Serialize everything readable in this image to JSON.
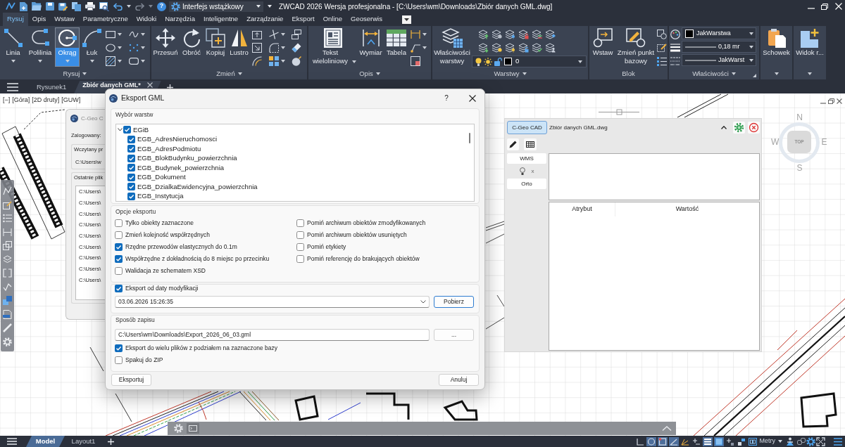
{
  "title_bar": {
    "help": "?",
    "workspace": "Interfejs wstążkowy",
    "title": "ZWCAD 2026 Wersja profesjonalna - [C:\\Users\\wm\\Downloads\\Zbiór danych GML.dwg]"
  },
  "ribbon_tabs": [
    {
      "label": "Rysuj",
      "selected": true
    },
    {
      "label": "Opis",
      "selected": false
    },
    {
      "label": "Wstaw",
      "selected": false
    },
    {
      "label": "Parametryczne",
      "selected": false
    },
    {
      "label": "Widoki",
      "selected": false
    },
    {
      "label": "Narzędzia",
      "selected": false
    },
    {
      "label": "Inteligentne",
      "selected": false
    },
    {
      "label": "Zarządzanie",
      "selected": false
    },
    {
      "label": "Eksport",
      "selected": false
    },
    {
      "label": "Online",
      "selected": false
    },
    {
      "label": "Geoserwis",
      "selected": false
    }
  ],
  "ribbon_groups": [
    {
      "kind": "draw",
      "label": "Rysuj",
      "dropdown": true,
      "buttons": [
        {
          "label": "Linia",
          "selected": false
        },
        {
          "label": "Polilinia",
          "selected": false
        },
        {
          "label": "Okrąg",
          "selected": true
        },
        {
          "label": "Łuk",
          "selected": false
        }
      ]
    },
    {
      "kind": "modify",
      "label": "Zmień",
      "dropdown": true,
      "buttons": [
        {
          "label": "Przesuń"
        },
        {
          "label": "Obróć"
        },
        {
          "label": "Kopiuj"
        },
        {
          "label": "Lustro"
        }
      ]
    },
    {
      "kind": "annotate",
      "label": "Opis",
      "dropdown": true,
      "buttons": [
        {
          "label": "Tekst wieloliniowy"
        },
        {
          "label": "Wymiar"
        },
        {
          "label": "Tabela"
        }
      ]
    },
    {
      "kind": "layers",
      "label": "Warstwy",
      "dropdown": true,
      "buttons": [
        {
          "label": "Właściwości warstwy"
        }
      ],
      "current_layer": "0"
    },
    {
      "kind": "block",
      "label": "Blok",
      "dropdown": false,
      "buttons": [
        {
          "label": "Wstaw"
        },
        {
          "label": "Zmień punkt bazowy"
        }
      ]
    },
    {
      "kind": "properties",
      "label": "Właściwości",
      "dropdown": true,
      "color_setting": "JakWarstwa",
      "lineweight": "0,18 mr",
      "linetype": "JakWarst"
    },
    {
      "kind": "clipboard",
      "dropdown": true,
      "buttons": [
        {
          "label": "Schowek"
        }
      ]
    },
    {
      "kind": "view",
      "dropdown": true,
      "buttons": [
        {
          "label": "Widok r..."
        }
      ]
    }
  ],
  "document_tabs": [
    {
      "label": "Rysunek1",
      "selected": false
    },
    {
      "label": "Zbiór danych GML*",
      "selected": true
    }
  ],
  "viewport_label": [
    "[−]",
    "[Góra]",
    "[2D druty]",
    "[GUW]"
  ],
  "background_dialog": {
    "title": "C-Geo C",
    "logged_in": "Zalogowany:",
    "project_group": "Wczytany pr",
    "project_path": "C:\\Users\\w",
    "recent_group": "Ostatnie plik",
    "recent_files": [
      "C:\\Users\\",
      "C:\\Users\\",
      "C:\\Users\\",
      "C:\\Users\\",
      "C:\\Users\\",
      "C:\\Users\\",
      "C:\\Users\\",
      "C:\\Users\\",
      "C:\\Users\\"
    ]
  },
  "export_dialog": {
    "title": "Eksport GML",
    "help": "?",
    "layer_group": {
      "title": "Wybór warstw",
      "tree": [
        {
          "label": "EGiB",
          "checked": true,
          "expanded": true,
          "children": [
            {
              "label": "EGB_AdresNieruchomosci",
              "checked": true
            },
            {
              "label": "EGB_AdresPodmiotu",
              "checked": true
            },
            {
              "label": "EGB_BlokBudynku_powierzchnia",
              "checked": true
            },
            {
              "label": "EGB_Budynek_powierzchnia",
              "checked": true
            },
            {
              "label": "EGB_Dokument",
              "checked": true
            },
            {
              "label": "EGB_DzialkaEwidencyjna_powierzchnia",
              "checked": true
            },
            {
              "label": "EGB_Instytucja",
              "checked": true
            }
          ]
        }
      ]
    },
    "options_group": {
      "title": "Opcje eksportu",
      "columns": [
        [
          {
            "label": "Tylko obiekty zaznaczone",
            "checked": false
          },
          {
            "label": "Zmień kolejność współrzędnych",
            "checked": false
          },
          {
            "label": "Rzędne przewodów elastycznych do 0.1m",
            "checked": true
          },
          {
            "label": "Współrzędne z dokładnością do 8 miejsc po przecinku",
            "checked": true
          },
          {
            "label": "Walidacja ze schematem XSD",
            "checked": false
          }
        ],
        [
          {
            "label": "Pomiń archiwum obiektów zmodyfikowanych",
            "checked": false
          },
          {
            "label": "Pomiń archiwum obiektów usuniętych",
            "checked": false
          },
          {
            "label": "Pomiń etykiety",
            "checked": false
          },
          {
            "label": "Pomiń referencję do brakujących obiektów",
            "checked": false
          }
        ]
      ]
    },
    "date_group": {
      "label": "Eksport od daty modyfikacji",
      "checked": true,
      "date": "03.06.2026 15:26:35",
      "button": "Pobierz"
    },
    "save_group": {
      "title": "Sposób zapisu",
      "path": "C:\\Users\\wm\\Downloads\\Export_2026_06_03.gml",
      "browse": "...",
      "options": [
        {
          "label": "Eksport do wielu plików z podziałem na zaznaczone bazy",
          "checked": true
        },
        {
          "label": "Spakuj do ZIP",
          "checked": false
        }
      ]
    },
    "buttons": [
      "Eksportuj",
      "Anuluj"
    ]
  },
  "side_panel": {
    "tab": "C-Geo CAD",
    "file": "Zbiór danych GML.dwg",
    "wms": "WMS",
    "wms_remove": "x",
    "orto": "Orto",
    "columns": [
      "Atrybut",
      "Wartość"
    ]
  },
  "compass": {
    "north": "N",
    "west": "W",
    "east": "E",
    "south": "S",
    "face": "TOP"
  },
  "layout_tabs": [
    {
      "label": "Model",
      "selected": true
    },
    {
      "label": "Layout1",
      "selected": false
    }
  ],
  "status_bar": {
    "toggles": [
      {
        "on": false
      },
      {
        "on": true
      },
      {
        "on": true
      },
      {
        "on": true
      },
      {
        "on": false
      },
      {
        "on": false
      },
      {
        "on": true
      },
      {
        "on": true
      },
      {
        "on": false
      },
      {
        "on": false
      },
      {
        "on": false
      }
    ],
    "units": "Metry"
  }
}
